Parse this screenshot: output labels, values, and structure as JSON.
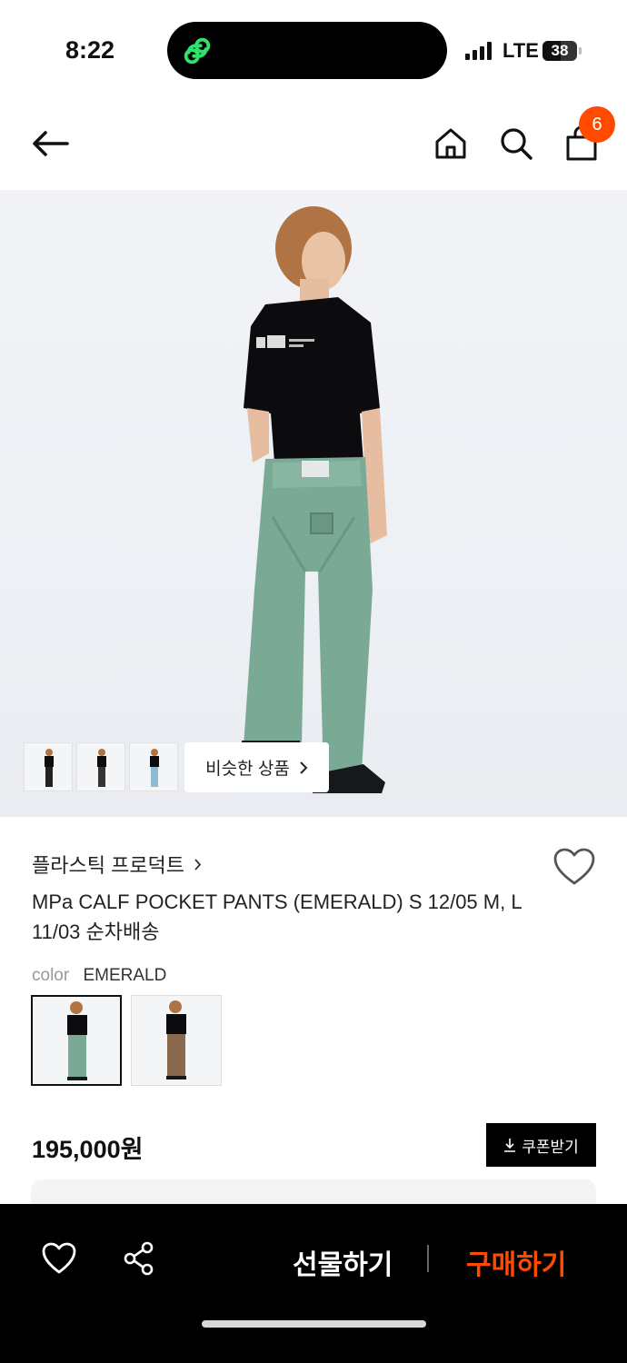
{
  "status_bar": {
    "time": "8:22",
    "network": "LTE",
    "battery": "38"
  },
  "nav": {
    "back_icon": "arrow-left-icon",
    "home_icon": "home-icon",
    "search_icon": "search-icon",
    "bag_icon": "shopping-bag-icon",
    "bag_count": "6"
  },
  "gallery": {
    "similar_label": "비슷한 상품",
    "thumbnails": [
      "thumb-front",
      "thumb-side",
      "thumb-back"
    ]
  },
  "product": {
    "brand": "플라스틱 프로덕트",
    "title": "MPa CALF POCKET PANTS (EMERALD) S 12/05 M, L 11/03 순차배송",
    "color_label": "color",
    "color_value": "EMERALD",
    "price": "195,000원",
    "coupon_label": "쿠폰받기"
  },
  "bottom_bar": {
    "like_icon": "heart-icon",
    "share_icon": "share-icon",
    "gift_label": "선물하기",
    "buy_label": "구매하기"
  },
  "colors": {
    "accent": "#ff4a00",
    "pants_emerald": "#7aa996",
    "pants_brown": "#8a6a4f"
  }
}
